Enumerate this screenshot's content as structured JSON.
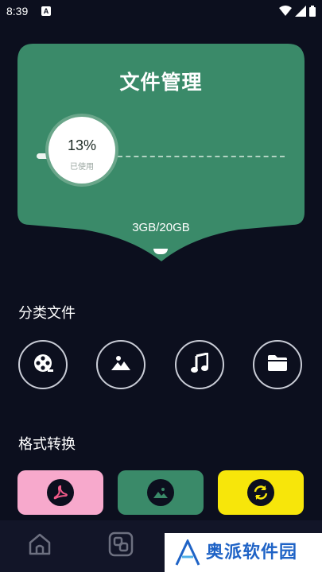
{
  "status_bar": {
    "time": "8:39",
    "notification": "A"
  },
  "storage": {
    "title": "文件管理",
    "percent": "13%",
    "percent_caption": "已使用",
    "used_fraction": 0.13,
    "usage": "3GB/20GB",
    "card_color": "#3a8a69"
  },
  "categories": {
    "heading": "分类文件",
    "items": [
      {
        "icon": "film-reel-icon"
      },
      {
        "icon": "image-icon"
      },
      {
        "icon": "music-note-icon"
      },
      {
        "icon": "folder-icon"
      }
    ]
  },
  "conversion": {
    "heading": "格式转换",
    "items": [
      {
        "icon": "pdf-icon",
        "color": "#f7a9cc"
      },
      {
        "icon": "image-icon",
        "color": "#3a8a69"
      },
      {
        "icon": "sync-icon",
        "color": "#f7e60a"
      }
    ]
  },
  "bottom_nav": {
    "items": [
      {
        "icon": "home-icon"
      },
      {
        "icon": "apps-icon"
      }
    ]
  },
  "watermark": {
    "brand": "奥派软件园"
  }
}
